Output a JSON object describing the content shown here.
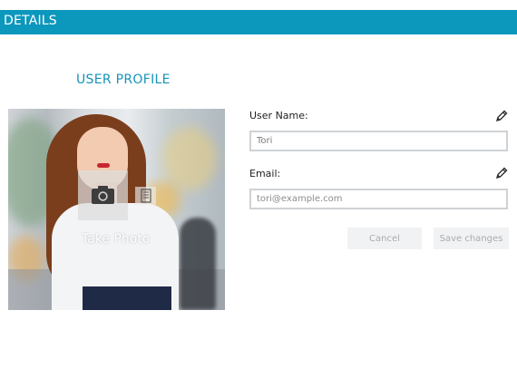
{
  "header": {
    "title": "DETAILS"
  },
  "profile": {
    "section_title": "USER PROFILE",
    "take_photo_label": "Take Photo"
  },
  "form": {
    "username": {
      "label": "User Name:",
      "value": "Tori"
    },
    "email": {
      "label": "Email:",
      "placeholder": "tori@example.com"
    }
  },
  "buttons": {
    "cancel": "Cancel",
    "save": "Save changes"
  },
  "colors": {
    "accent": "#0c97bd",
    "section_title": "#1693b9"
  },
  "icons": [
    "camera-icon",
    "file-icon",
    "pencil-icon"
  ]
}
